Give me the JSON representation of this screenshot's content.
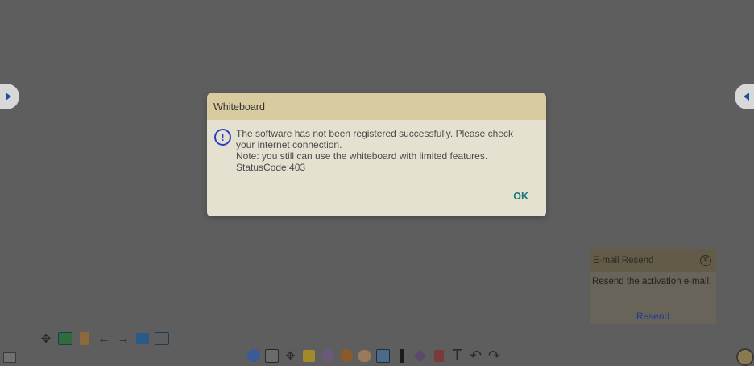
{
  "dialog": {
    "title": "Whiteboard",
    "message_lines": [
      "The software has not been registered successfully. Please check",
      "your internet connection.",
      "Note: you still can use the whiteboard with limited features.",
      "StatusCode:403"
    ],
    "ok_label": "OK",
    "icon": "exclamation-circle-icon"
  },
  "resend_panel": {
    "title": "E-mail Resend",
    "message": "Resend the activation e-mail.",
    "action_label": "Resend"
  },
  "left_toolbar": {
    "icons": [
      "move-icon",
      "image-icon",
      "book-icon",
      "arrow-left-icon",
      "arrow-right-icon",
      "add-page-icon",
      "page-number-icon"
    ]
  },
  "bottom_toolbar": {
    "icons": [
      "users-icon",
      "screen-capture-icon",
      "move-icon",
      "folder-icon",
      "settings-icon",
      "browser-icon",
      "hand-icon",
      "select-icon",
      "pen-icon",
      "eraser-icon",
      "magic-pen-icon",
      "text-icon",
      "undo-icon",
      "redo-icon"
    ]
  },
  "colors": {
    "background": "#5e5e5e",
    "dialog_bg": "#e4e1d0",
    "dialog_header": "#d9cba0",
    "ok_text": "#1a7a80",
    "icon_blue": "#2b3ec8"
  }
}
